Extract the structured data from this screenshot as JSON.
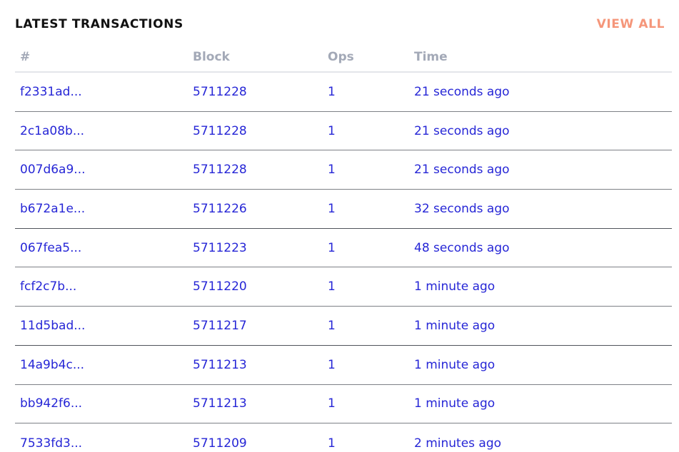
{
  "header": {
    "title": "LATEST TRANSACTIONS",
    "view_all_label": "VIEW ALL"
  },
  "colors": {
    "accent": "#f5967a",
    "link": "#2626d6",
    "header_text": "#a3a9b7",
    "title_text": "#111111"
  },
  "table": {
    "columns": [
      "#",
      "Block",
      "Ops",
      "Time"
    ],
    "rows": [
      {
        "hash": "f2331ad...",
        "block": "5711228",
        "ops": "1",
        "time": "21 seconds ago"
      },
      {
        "hash": "2c1a08b...",
        "block": "5711228",
        "ops": "1",
        "time": "21 seconds ago"
      },
      {
        "hash": "007d6a9...",
        "block": "5711228",
        "ops": "1",
        "time": "21 seconds ago"
      },
      {
        "hash": "b672a1e...",
        "block": "5711226",
        "ops": "1",
        "time": "32 seconds ago"
      },
      {
        "hash": "067fea5...",
        "block": "5711223",
        "ops": "1",
        "time": "48 seconds ago"
      },
      {
        "hash": "fcf2c7b...",
        "block": "5711220",
        "ops": "1",
        "time": "1 minute ago"
      },
      {
        "hash": "11d5bad...",
        "block": "5711217",
        "ops": "1",
        "time": "1 minute ago"
      },
      {
        "hash": "14a9b4c...",
        "block": "5711213",
        "ops": "1",
        "time": "1 minute ago"
      },
      {
        "hash": "bb942f6...",
        "block": "5711213",
        "ops": "1",
        "time": "1 minute ago"
      },
      {
        "hash": "7533fd3...",
        "block": "5711209",
        "ops": "1",
        "time": "2 minutes ago"
      }
    ]
  }
}
